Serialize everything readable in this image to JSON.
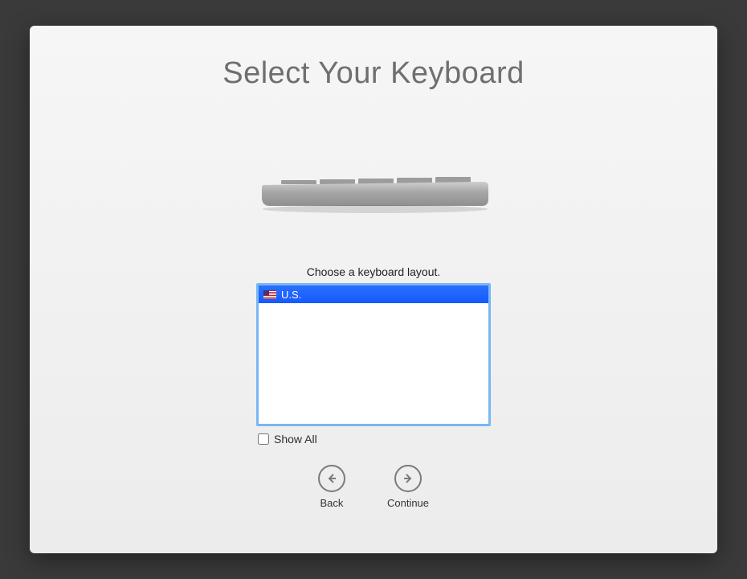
{
  "title": "Select Your Keyboard",
  "instruction": "Choose a keyboard layout.",
  "layouts": [
    {
      "name": "U.S.",
      "flag": "us",
      "selected": true
    }
  ],
  "show_all": {
    "label": "Show All",
    "checked": false
  },
  "buttons": {
    "back": "Back",
    "continue": "Continue"
  }
}
